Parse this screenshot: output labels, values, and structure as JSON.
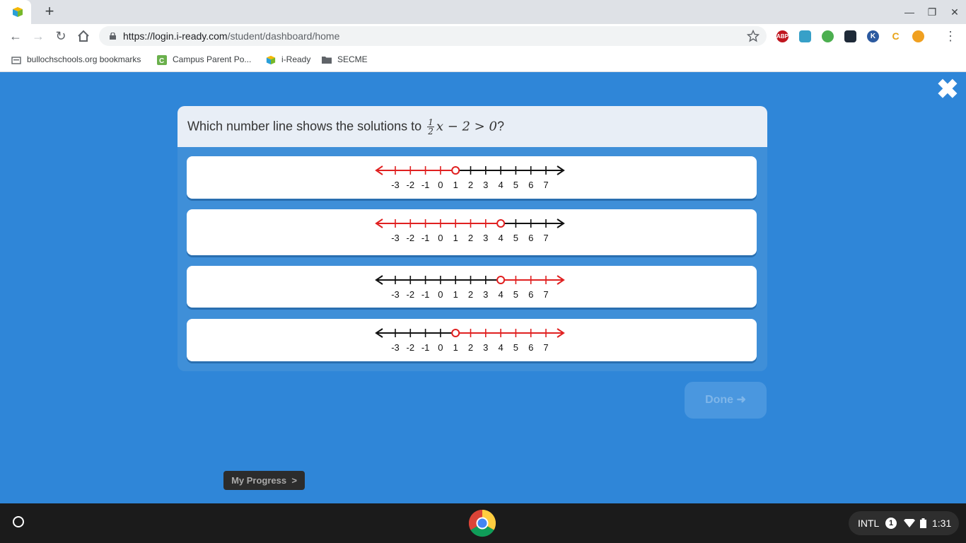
{
  "browser": {
    "url_host": "https://login.i-ready.com",
    "url_path": "/student/dashboard/home",
    "new_tab": "+",
    "extensions": [
      "ABP",
      "",
      "",
      "",
      "K",
      "C",
      ""
    ],
    "bookmarks": [
      {
        "label": "bullochschools.org bookmarks",
        "icon": "folder-icon"
      },
      {
        "label": "Campus Parent Po...",
        "icon": "campus-icon"
      },
      {
        "label": "i-Ready",
        "icon": "iready-icon"
      },
      {
        "label": "SECME",
        "icon": "folder-icon"
      }
    ]
  },
  "question": {
    "prefix": "Which number line shows the solutions to",
    "frac_num": "1",
    "frac_den": "2",
    "expr": "x − 2 > 0",
    "suffix": "?"
  },
  "number_line_ticks": [
    "-3",
    "-2",
    "-1",
    "0",
    "1",
    "2",
    "3",
    "4",
    "5",
    "6",
    "7"
  ],
  "options": [
    {
      "open_circle_at": 1,
      "shaded": "left"
    },
    {
      "open_circle_at": 4,
      "shaded": "left"
    },
    {
      "open_circle_at": 4,
      "shaded": "right"
    },
    {
      "open_circle_at": 1,
      "shaded": "right"
    }
  ],
  "colors": {
    "shaded": "#e02020",
    "line": "#111111",
    "background": "#2f86d8"
  },
  "done_button": "Done",
  "my_progress": "My Progress",
  "my_progress_chevron": ">",
  "tray": {
    "keyboard": "INTL",
    "notifications": "1",
    "time": "1:31"
  }
}
